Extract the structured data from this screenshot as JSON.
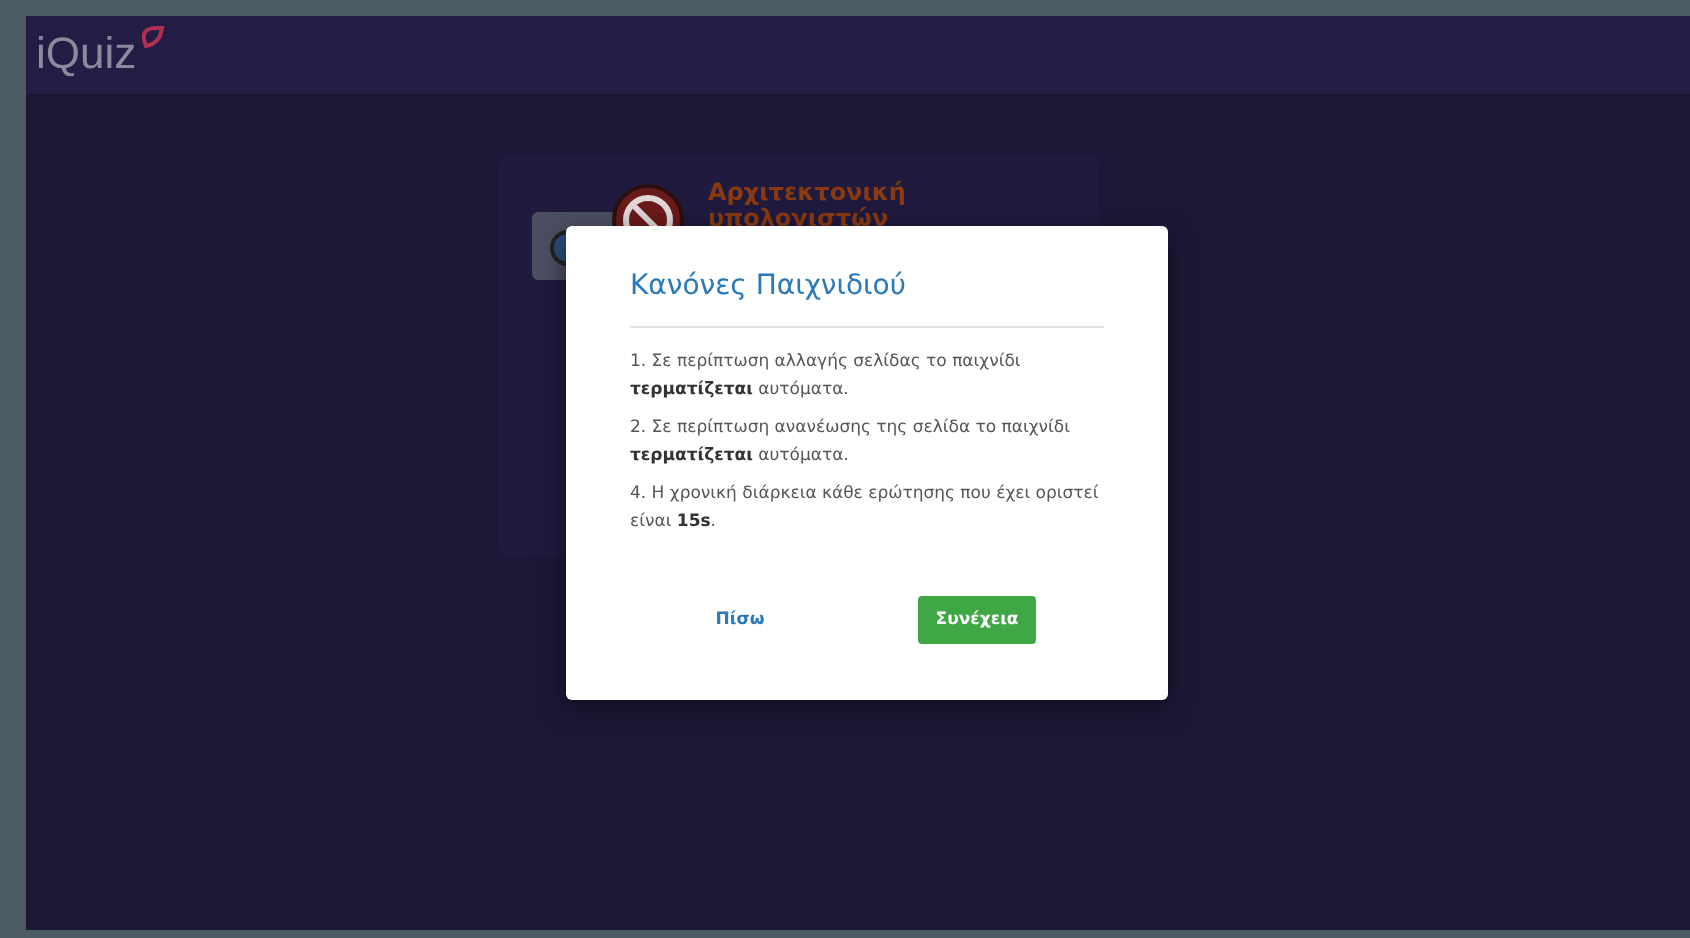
{
  "header": {
    "logo": "iQuiz"
  },
  "quiz_card": {
    "title": "Αρχιτεκτονική υπολογιστών"
  },
  "modal": {
    "title": "Κανόνες Παιχνιδιού",
    "rules": [
      "1. Σε περίπτωση αλλαγής σελίδας το παιχνίδι **τερματίζεται** αυτόματα.",
      "2. Σε περίπτωση ανανέωσης της σελίδα το παιχνίδι **τερματίζεται** αυτόματα.",
      "4. Η χρονική διάρκεια κάθε ερώτησης που έχει οριστεί είναι **15s**."
    ],
    "buttons": [
      {
        "label": "Πίσω",
        "kind": "text"
      },
      {
        "label": "Συνέχεια",
        "kind": "primary"
      }
    ]
  }
}
